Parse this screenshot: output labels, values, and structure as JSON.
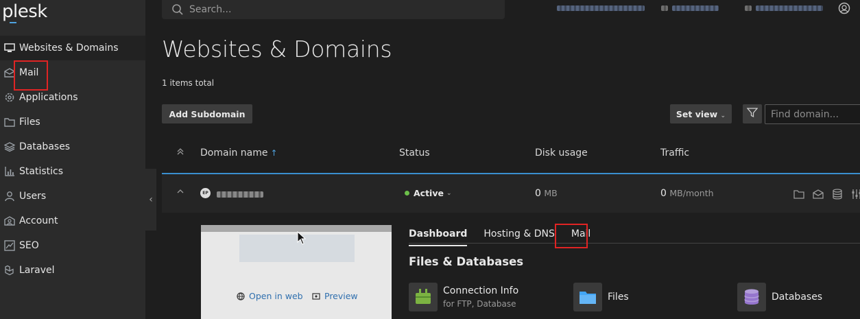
{
  "brand": {
    "logo_text": "plesk",
    "accent": "#4fa3e0"
  },
  "sidebar": {
    "items": [
      {
        "label": "Websites & Domains",
        "icon": "monitor-icon"
      },
      {
        "label": "Mail",
        "icon": "envelope-icon"
      },
      {
        "label": "Applications",
        "icon": "gear-icon"
      },
      {
        "label": "Files",
        "icon": "folder-icon"
      },
      {
        "label": "Databases",
        "icon": "layers-icon"
      },
      {
        "label": "Statistics",
        "icon": "bar-chart-icon"
      },
      {
        "label": "Users",
        "icon": "user-icon"
      },
      {
        "label": "Account",
        "icon": "account-icon"
      },
      {
        "label": "SEO",
        "icon": "trend-icon"
      },
      {
        "label": "Laravel",
        "icon": "laravel-icon"
      }
    ],
    "collapse_glyph": "‹"
  },
  "header": {
    "search_placeholder": "Search..."
  },
  "main": {
    "title": "Websites & Domains",
    "items_total": "1 items total",
    "add_subdomain_label": "Add Subdomain",
    "set_view_label": "Set view",
    "find_domain_placeholder": "Find domain...",
    "columns": {
      "domain": "Domain name",
      "sort_arrow": "↑",
      "status": "Status",
      "disk": "Disk usage",
      "traffic": "Traffic"
    },
    "row": {
      "favicon_text": "EP",
      "status": "Active",
      "disk_value": "0",
      "disk_unit": "MB",
      "traffic_value": "0",
      "traffic_unit": "MB/month"
    },
    "preview": {
      "open_in_web": "Open in web",
      "preview": "Preview"
    },
    "tabs": [
      {
        "label": "Dashboard",
        "active": true
      },
      {
        "label": "Hosting & DNS",
        "active": false
      },
      {
        "label": "Mail",
        "active": false
      }
    ],
    "section_title": "Files & Databases",
    "tools": [
      {
        "name": "Connection Info",
        "sub": "for FTP, Database"
      },
      {
        "name": "Files",
        "sub": ""
      },
      {
        "name": "Databases",
        "sub": ""
      }
    ]
  },
  "colors": {
    "status_active": "#6cc04a",
    "highlight": "#e02424",
    "link": "#2f6fae"
  }
}
